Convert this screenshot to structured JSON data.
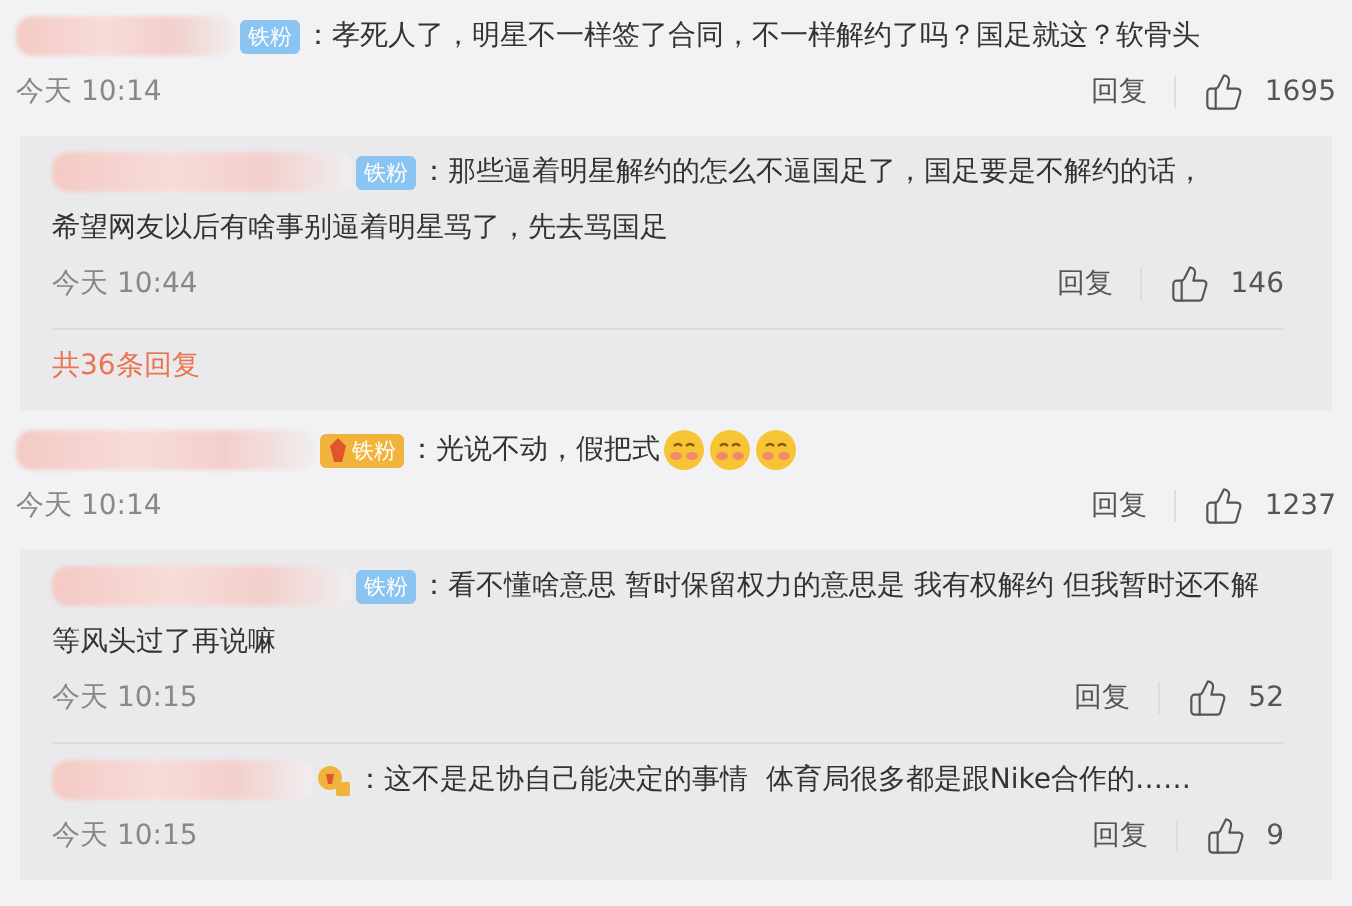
{
  "comments": [
    {
      "badge": {
        "kind": "blue",
        "text": "铁粉"
      },
      "lines": [
        "：孝死人了，明星不一样签了合同，不一样解约了吗？国足就这？软骨头"
      ],
      "time": "今天 10:14",
      "reply_label": "回复",
      "likes": "1695",
      "replies": [
        {
          "badge": {
            "kind": "blue",
            "text": "铁粉"
          },
          "lines": [
            "：那些逼着明星解约的怎么不逼国足了，国足要是不解约的话，",
            "希望网友以后有啥事别逼着明星骂了，先去骂国足"
          ],
          "time": "今天 10:44",
          "reply_label": "回复",
          "likes": "146"
        }
      ],
      "more": "共36条回复"
    },
    {
      "badge": {
        "kind": "gold",
        "text": "铁粉"
      },
      "lines": [
        "：光说不动，假把式"
      ],
      "emojis": [
        {
          "kind": "blush"
        },
        {
          "kind": "blush"
        },
        {
          "kind": "blush"
        }
      ],
      "time": "今天 10:14",
      "reply_label": "回复",
      "likes": "1237",
      "replies": [
        {
          "badge": {
            "kind": "blue",
            "text": "铁粉"
          },
          "lines": [
            "：看不懂啥意思 暂时保留权力的意思是 我有权解约 但我暂时还不解",
            "等风头过了再说嘛"
          ],
          "time": "今天 10:15",
          "reply_label": "回复",
          "likes": "52"
        },
        {
          "badge": {
            "kind": "icon"
          },
          "lines": [
            "：这不是足协自己能决定的事情  体育局很多都是跟Nike合作的……"
          ],
          "time": "今天 10:15",
          "reply_label": "回复",
          "likes": "9"
        }
      ]
    }
  ]
}
